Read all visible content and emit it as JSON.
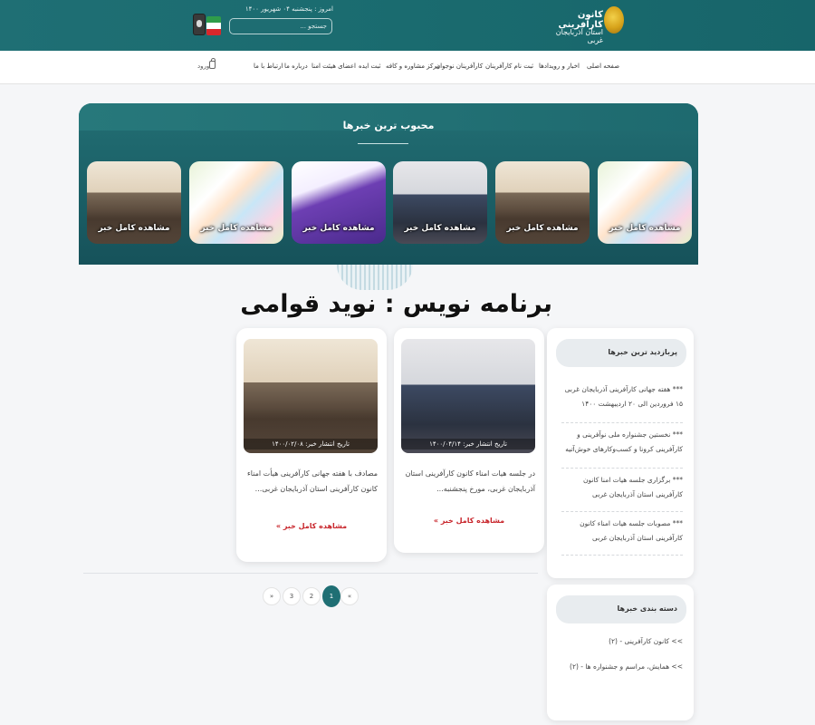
{
  "header": {
    "logo_title": "کانون کارآفرینی",
    "logo_subtitle": "استان آذربایجان غربی",
    "date_text": "امروز : پنجشنبه ۰۴ شهریور ۱۴۰۰",
    "search_placeholder": "جستجو ..."
  },
  "nav": {
    "items": [
      "صفحه اصلی",
      "اخبار و رویدادها",
      "ثبت نام کارآفرینان",
      "کارآفرینان نوجوان",
      "مرکز مشاوره و کافه",
      "ثبت ایده",
      "اعضای هیئت امنا",
      "درباره ما",
      "ارتباط با ما"
    ],
    "login_label": "ورود"
  },
  "popular": {
    "title": "محبوب ترین خبرها",
    "cards": [
      {
        "label": "مشاهده کامل خبر",
        "image": "poster"
      },
      {
        "label": "مشاهده کامل خبر",
        "image": "meeting"
      },
      {
        "label": "مشاهده کامل خبر",
        "image": "meeting2"
      },
      {
        "label": "مشاهده کامل خبر",
        "image": "purple"
      },
      {
        "label": "مشاهده کامل خبر",
        "image": "poster"
      },
      {
        "label": "مشاهده کامل خبر",
        "image": "meeting"
      }
    ]
  },
  "watermark": "برنامه نویس : نوید قوامی",
  "news": [
    {
      "date": "تاریخ انتشار خبر: ۱۴۰۰/۰۴/۱۴",
      "excerpt": "در جلسه هیات امناء کانون کارآفرینی استان آذربایجان غربی، مورخ پنجشنبه...",
      "more": "مشاهده کامل خبر »"
    },
    {
      "date": "تاریخ انتشار خبر: ۱۴۰۰/۰۲/۰۸",
      "excerpt": "مصادف با هفته جهانی کارآفرینی هیأت امناء کانون کارآفرینی استان آذربایجان غربی...",
      "more": "مشاهده کامل خبر »"
    }
  ],
  "pagination": {
    "prev": "«",
    "pages": [
      "1",
      "2",
      "3"
    ],
    "next": "»",
    "active": "1"
  },
  "sidebar": {
    "top_news": {
      "title": "پربازدید ترین خبرها",
      "items": [
        "*** هفته جهانی کارآفرینی آذربایجان غربی ۱۵ فروردین الی ۲۰ اردیبهشت ۱۴۰۰",
        "*** نخستین جشنواره ملی نوآفرینی و کارآفرینی کرونا و کسب‌وکارهای خوش‌آتیه",
        "*** برگزاری جلسه هیات امنا کانون کارآفرینی استان آذربایجان غربی",
        "*** مصوبات جلسه هیات امناء کانون کارآفرینی استان آذربایجان غربی"
      ]
    },
    "categories": {
      "title": "دسته بندی خبرها",
      "items": [
        ">> کانون کارآفرینی - (۲)",
        ">> همایش، مراسم و جشنواره ها - (۲)"
      ]
    }
  },
  "colors": {
    "brand_teal": "#1f6f74",
    "accent_red": "#c8262c",
    "logo_gold": "#d6a21a"
  }
}
